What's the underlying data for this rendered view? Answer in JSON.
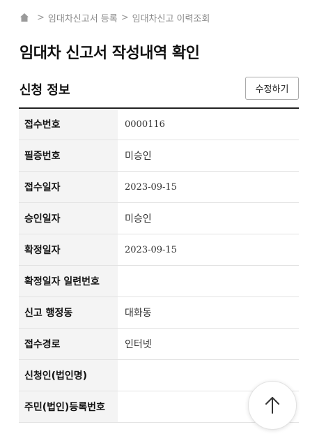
{
  "breadcrumb": {
    "home_icon": "home-icon",
    "separator": ">",
    "items": [
      "임대차신고서 등록",
      "임대차신고 이력조회"
    ]
  },
  "page_title": "임대차 신고서 작성내역 확인",
  "section": {
    "title": "신청 정보",
    "edit_label": "수정하기"
  },
  "rows": [
    {
      "label": "접수번호",
      "value": "0000116"
    },
    {
      "label": "필증번호",
      "value": "미승인"
    },
    {
      "label": "접수일자",
      "value": "2023-09-15"
    },
    {
      "label": "승인일자",
      "value": "미승인"
    },
    {
      "label": "확정일자",
      "value": "2023-09-15"
    },
    {
      "label": "확정일자 일련번호",
      "value": ""
    },
    {
      "label": "신고 행정동",
      "value": "대화동"
    },
    {
      "label": "접수경로",
      "value": "인터넷"
    },
    {
      "label": "신청인(법인명)",
      "value": ""
    },
    {
      "label": "주민(법인)등록번호",
      "value": ""
    }
  ],
  "scroll_top_icon": "arrow-up-icon"
}
